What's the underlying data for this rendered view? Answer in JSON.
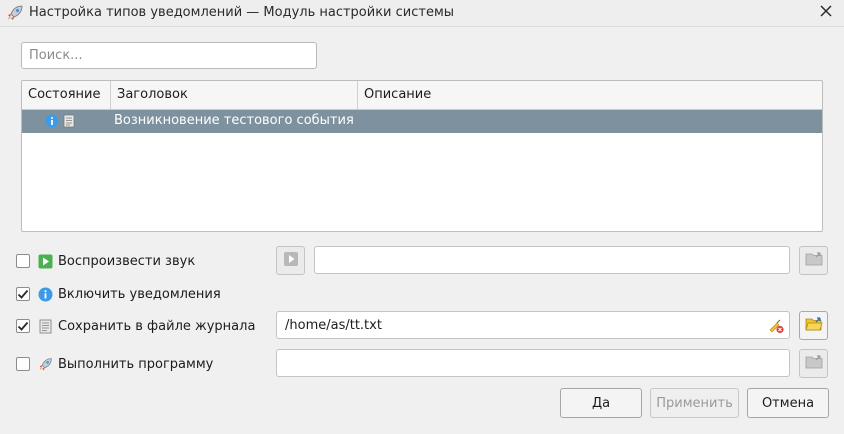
{
  "window": {
    "title": "Настройка типов уведомлений — Модуль настройки системы",
    "app_icon": "rocket-icon",
    "close_icon": "close-icon"
  },
  "search": {
    "placeholder": "Поиск...",
    "value": ""
  },
  "table": {
    "columns": [
      "Состояние",
      "Заголовок",
      "Описание"
    ],
    "rows": [
      {
        "status_icons": [
          "info-icon",
          "log-file-icon"
        ],
        "title": "Возникновение тестового события",
        "description": "",
        "selected": true
      }
    ]
  },
  "options": {
    "play_sound": {
      "label": "Воспроизвести звук",
      "checked": false,
      "icon": "play-sound-icon",
      "path": ""
    },
    "show_notifications": {
      "label": "Включить уведомления",
      "checked": true,
      "icon": "info-icon"
    },
    "log_to_file": {
      "label": "Сохранить в файле журнала",
      "checked": true,
      "icon": "log-file-icon",
      "path": "/home/as/tt.txt"
    },
    "run_program": {
      "label": "Выполнить программу",
      "checked": false,
      "icon": "rocket-icon",
      "path": ""
    }
  },
  "buttons": {
    "ok": "Да",
    "apply": "Применить",
    "cancel": "Отмена"
  },
  "colors": {
    "selection": "#7e919f",
    "info_blue": "#3d9ae8",
    "play_green": "#4caf50",
    "folder_yellow": "#f2c230"
  }
}
